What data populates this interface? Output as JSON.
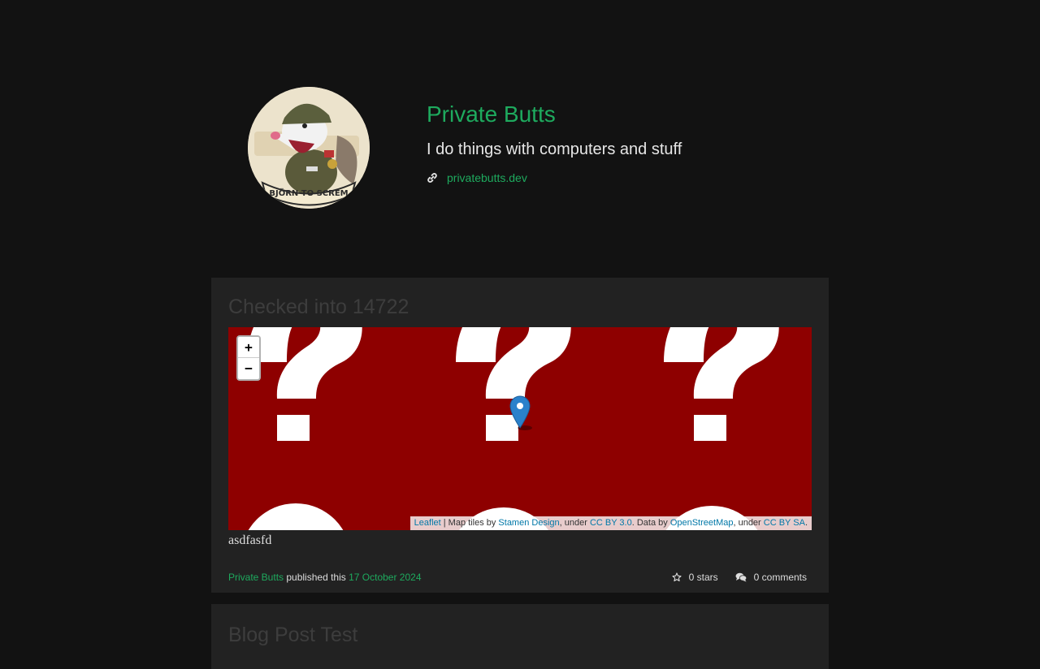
{
  "profile": {
    "name": "Private Butts",
    "tagline": "I do things with computers and stuff",
    "website_label": "privatebutts.dev",
    "avatar_badge_text": "BJÖRN TO SCREM",
    "link_icon": "link-icon"
  },
  "posts": [
    {
      "title": "Checked into 14722",
      "map": {
        "zoom_in_label": "+",
        "zoom_out_label": "−",
        "tile_color": "#8e0000",
        "attribution": {
          "leaflet": "Leaflet",
          "sep1": " | Map tiles by ",
          "stamen": "Stamen Design",
          "sep2": ", under ",
          "ccby30": "CC BY 3.0",
          "sep3": ". Data by ",
          "osm": "OpenStreetMap",
          "sep4": ", under ",
          "ccbysa": "CC BY SA",
          "end": "."
        }
      },
      "body": "asdfasfd",
      "meta": {
        "author": "Private Butts",
        "published_text": " published this ",
        "date": "17 October 2024"
      },
      "stars_label": "0 stars",
      "comments_label": "0 comments"
    },
    {
      "title": "Blog Post Test"
    }
  ],
  "colors": {
    "accent": "#1eaa5e",
    "background": "#121212",
    "card": "#222222"
  }
}
